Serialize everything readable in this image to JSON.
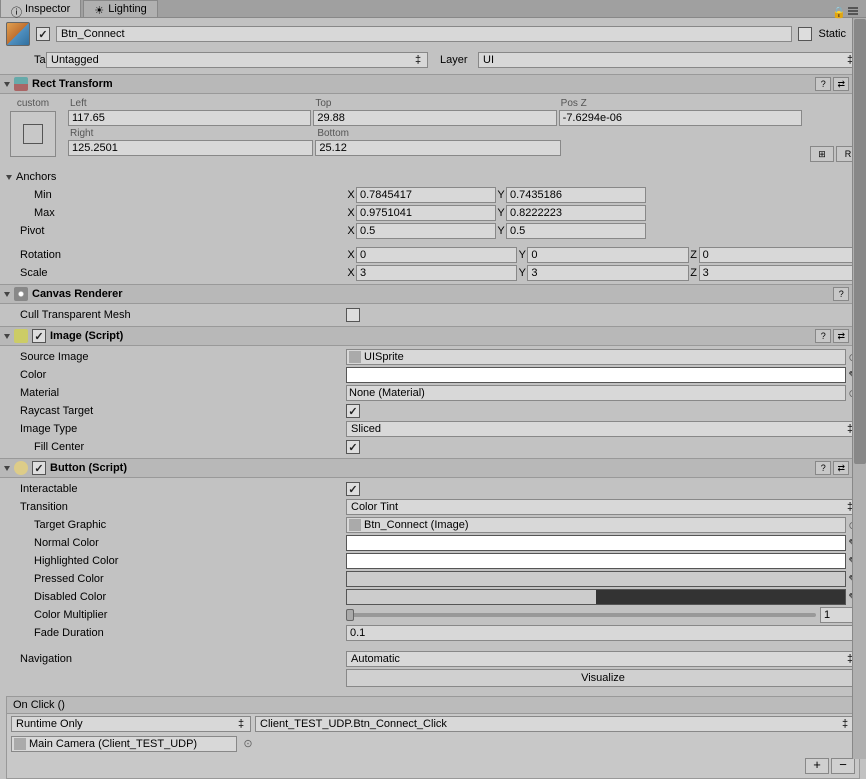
{
  "tabs": {
    "inspector": "Inspector",
    "lighting": "Lighting"
  },
  "header": {
    "name": "Btn_Connect",
    "static_label": "Static"
  },
  "tagRow": {
    "tag_label": "Tag",
    "tag_value": "Untagged",
    "layer_label": "Layer",
    "layer_value": "UI"
  },
  "rectTransform": {
    "title": "Rect Transform",
    "preset": "custom",
    "left_label": "Left",
    "left": "117.65",
    "top_label": "Top",
    "top": "29.88",
    "posz_label": "Pos Z",
    "posz": "-7.6294e-06",
    "right_label": "Right",
    "right": "125.2501",
    "bottom_label": "Bottom",
    "bottom": "25.12",
    "anchors_label": "Anchors",
    "min_label": "Min",
    "min_x": "0.7845417",
    "min_y": "0.7435186",
    "max_label": "Max",
    "max_x": "0.9751041",
    "max_y": "0.8222223",
    "pivot_label": "Pivot",
    "pivot_x": "0.5",
    "pivot_y": "0.5",
    "rotation_label": "Rotation",
    "rot_x": "0",
    "rot_y": "0",
    "rot_z": "0",
    "scale_label": "Scale",
    "scale_x": "3",
    "scale_y": "3",
    "scale_z": "3",
    "x": "X",
    "y": "Y",
    "z": "Z",
    "r_btn": "R"
  },
  "canvasRenderer": {
    "title": "Canvas Renderer",
    "cull_label": "Cull Transparent Mesh"
  },
  "image": {
    "title": "Image (Script)",
    "source_label": "Source Image",
    "source_value": "UISprite",
    "color_label": "Color",
    "material_label": "Material",
    "material_value": "None (Material)",
    "raycast_label": "Raycast Target",
    "type_label": "Image Type",
    "type_value": "Sliced",
    "fill_label": "Fill Center"
  },
  "button": {
    "title": "Button (Script)",
    "interactable_label": "Interactable",
    "transition_label": "Transition",
    "transition_value": "Color Tint",
    "target_label": "Target Graphic",
    "target_value": "Btn_Connect (Image)",
    "normal_label": "Normal Color",
    "highlighted_label": "Highlighted Color",
    "pressed_label": "Pressed Color",
    "disabled_label": "Disabled Color",
    "multiplier_label": "Color Multiplier",
    "multiplier_value": "1",
    "fade_label": "Fade Duration",
    "fade_value": "0.1",
    "navigation_label": "Navigation",
    "navigation_value": "Automatic",
    "visualize_label": "Visualize",
    "onclick_label": "On Click ()",
    "runtime_value": "Runtime Only",
    "method_value": "Client_TEST_UDP.Btn_Connect_Click",
    "target_obj_value": "Main Camera (Client_TEST_UDP)"
  }
}
